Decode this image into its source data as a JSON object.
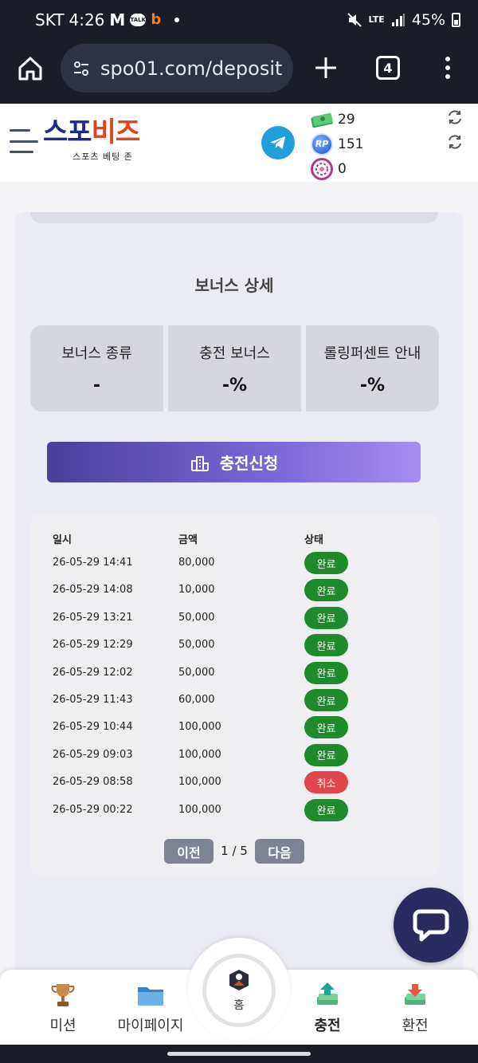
{
  "status_bar": {
    "carrier": "SKT",
    "time": "4:26",
    "app_m": "M",
    "app_talk": "TALK",
    "app_b": "b",
    "lte": "LTE",
    "battery": "45%"
  },
  "browser": {
    "url": "spo01.com/deposit",
    "tab_count": "4"
  },
  "header": {
    "logo_part1": "스포",
    "logo_part2": "비즈",
    "logo_sub": "스포츠 베팅 존",
    "wallet": {
      "cash": "29",
      "rp": "151",
      "rp_badge": "RP",
      "chip": "0"
    }
  },
  "bonus": {
    "title": "보너스 상세",
    "cells": [
      {
        "label": "보너스 종류",
        "value": "-"
      },
      {
        "label": "충전 보너스",
        "value": "-%"
      },
      {
        "label": "롤링퍼센트 안내",
        "value": "-%"
      }
    ]
  },
  "charge_button_label": "충전신청",
  "history": {
    "headers": {
      "date": "일시",
      "amount": "금액",
      "status": "상태"
    },
    "rows": [
      {
        "date": "26-05-29 14:41",
        "amount": "80,000",
        "status": "완료",
        "kind": "ok"
      },
      {
        "date": "26-05-29 14:08",
        "amount": "10,000",
        "status": "완료",
        "kind": "ok"
      },
      {
        "date": "26-05-29 13:21",
        "amount": "50,000",
        "status": "완료",
        "kind": "ok"
      },
      {
        "date": "26-05-29 12:29",
        "amount": "50,000",
        "status": "완료",
        "kind": "ok"
      },
      {
        "date": "26-05-29 12:02",
        "amount": "50,000",
        "status": "완료",
        "kind": "ok"
      },
      {
        "date": "26-05-29 11:43",
        "amount": "60,000",
        "status": "완료",
        "kind": "ok"
      },
      {
        "date": "26-05-29 10:44",
        "amount": "100,000",
        "status": "완료",
        "kind": "ok"
      },
      {
        "date": "26-05-29 09:03",
        "amount": "100,000",
        "status": "완료",
        "kind": "ok"
      },
      {
        "date": "26-05-29 08:58",
        "amount": "100,000",
        "status": "취소",
        "kind": "cancel"
      },
      {
        "date": "26-05-29 00:22",
        "amount": "100,000",
        "status": "완료",
        "kind": "ok"
      }
    ],
    "pager": {
      "prev": "이전",
      "info": "1 / 5",
      "next": "다음"
    }
  },
  "bottom_nav": {
    "mission": "미션",
    "mypage": "마이페이지",
    "home": "홈",
    "deposit": "충전",
    "withdraw": "환전"
  },
  "colors": {
    "status_ok": "#1f8a2c",
    "status_cancel": "#e0474c",
    "logo_blue": "#1d2a8a",
    "logo_orange": "#e2431d",
    "telegram": "#229ed9",
    "chat": "#2b2a5e"
  }
}
